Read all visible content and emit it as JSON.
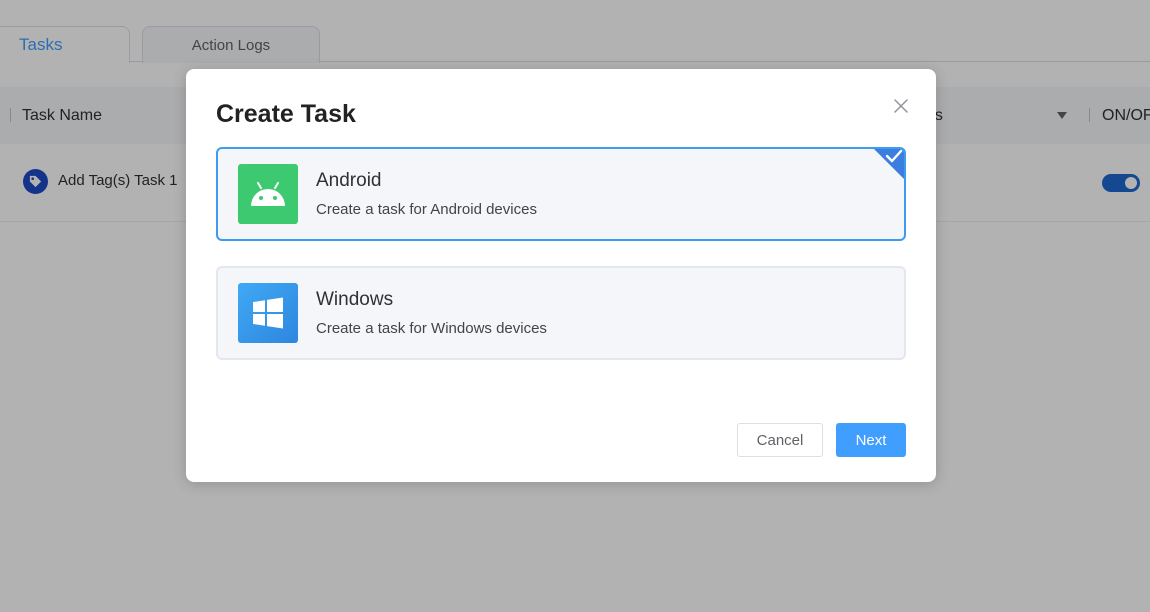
{
  "tabs": [
    {
      "label": "Tasks",
      "active": true
    },
    {
      "label": "Action Logs",
      "active": false
    }
  ],
  "table": {
    "headers": {
      "task_name": "Task Name",
      "actions_partial": "ns",
      "on_off": "ON/OF"
    },
    "rows": [
      {
        "task_name": "Add Tag(s) Task 1",
        "enabled": true
      }
    ]
  },
  "dialog": {
    "title": "Create Task",
    "options": [
      {
        "title": "Android",
        "description": "Create a task for Android devices",
        "icon": "android-icon",
        "selected": true
      },
      {
        "title": "Windows",
        "description": "Create a task for Windows devices",
        "icon": "windows-icon",
        "selected": false
      }
    ],
    "cancel_label": "Cancel",
    "next_label": "Next"
  },
  "colors": {
    "accent": "#409eff",
    "android_green": "#3dc96f",
    "windows_blue": "#3fa9f5",
    "tag_icon_blue": "#1d49c8"
  }
}
